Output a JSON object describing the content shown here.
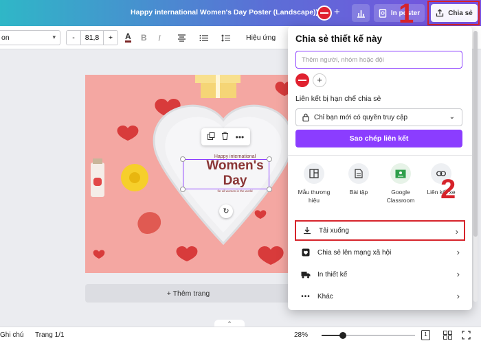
{
  "topbar": {
    "document_title": "Happy international Women's  Day Poster (Landscape))",
    "add_people_symbol": "+",
    "print_label": "In poster",
    "share_label": "Chia sẻ"
  },
  "toolbar": {
    "font_name": "on",
    "font_size": "81,8",
    "size_minus": "-",
    "size_plus": "+",
    "color_label": "A",
    "bold_label": "B",
    "italic_label": "I",
    "effects_label": "Hiệu ứng"
  },
  "canvas": {
    "happy_text": "Happy international",
    "title_line1": "Women's",
    "title_line2": "Day",
    "tagline": "for all women in the world",
    "add_page_label": "+ Thêm trang"
  },
  "footer": {
    "notes_label": "Ghi chú",
    "page_count": "Trang 1/1",
    "zoom": "28%",
    "zoom_fraction": 0.23,
    "pages_indicator": "1"
  },
  "share_panel": {
    "title": "Chia sẻ thiết kế này",
    "invite_placeholder": "Thêm người, nhóm hoặc đội",
    "add_symbol": "+",
    "link_section_label": "Liên kết bị hạn chế chia sẻ",
    "access_value": "Chỉ bạn mới có quyền truy cập",
    "copy_link_label": "Sao chép liên kết",
    "options": [
      {
        "label": "Mẫu thương hiệu",
        "icon": "template-icon"
      },
      {
        "label": "Bài tập",
        "icon": "homework-icon"
      },
      {
        "label": "Google Classroom",
        "icon": "classroom-icon"
      },
      {
        "label": "Liên kết xe",
        "icon": "link-icon"
      }
    ],
    "rows": [
      {
        "label": "Tải xuống",
        "icon": "download-icon"
      },
      {
        "label": "Chia sẻ lên mạng xã hội",
        "icon": "heart-icon"
      },
      {
        "label": "In thiết kế",
        "icon": "truck-icon"
      },
      {
        "label": "Khác",
        "icon": "more-icon"
      }
    ]
  },
  "annotations": {
    "step1": "1",
    "step2": "2"
  },
  "colors": {
    "accent_purple": "#8b3dff",
    "annotation_red": "#d6232a",
    "poster_background": "#f4a7a2"
  }
}
